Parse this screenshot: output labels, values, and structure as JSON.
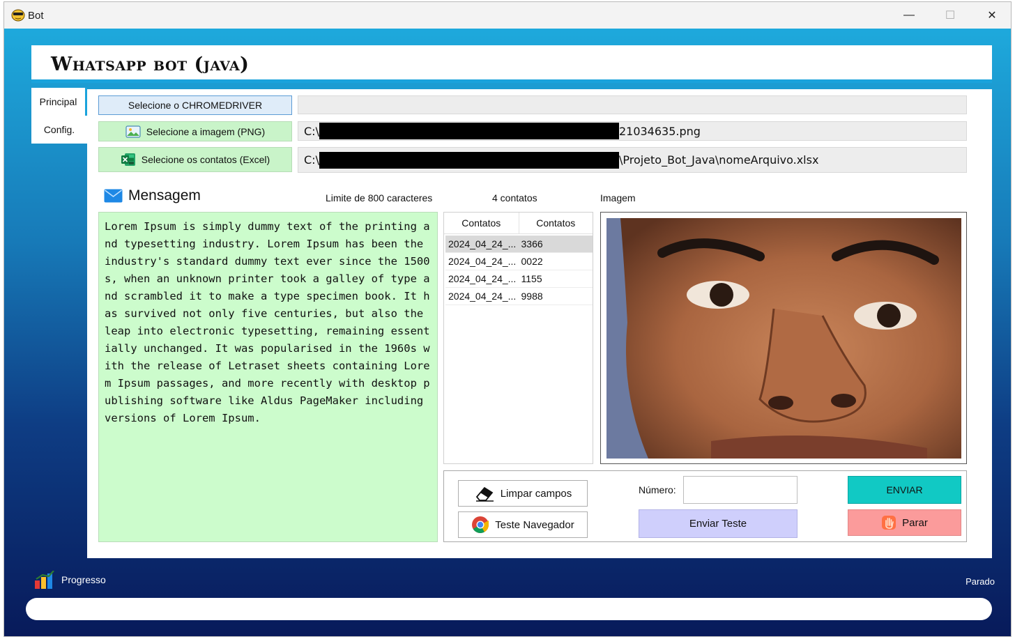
{
  "window": {
    "title": "Bot",
    "minimize_glyph": "—",
    "maximize_glyph": "☐",
    "close_glyph": "✕"
  },
  "header": {
    "app_title": "Whatsapp bot (java)"
  },
  "tabs": [
    {
      "label": "Principal",
      "active": true
    },
    {
      "label": "Config.",
      "active": false
    }
  ],
  "file_selectors": {
    "chromedriver": {
      "button_label": "Selecione o CHROMEDRIVER",
      "path": ""
    },
    "image": {
      "button_label": "Selecione a imagem (PNG)",
      "icon": "image-icon",
      "path_prefix": "C:\\",
      "path_suffix": "21034635.png"
    },
    "contacts": {
      "button_label": "Selecione os contatos (Excel)",
      "icon": "excel-icon",
      "path_prefix": "C:\\",
      "path_suffix": "\\Projeto_Bot_Java\\nomeArquivo.xlsx"
    }
  },
  "message": {
    "title": "Mensagem",
    "icon": "envelope-icon",
    "limit_label": "Limite de 800 caracteres",
    "text": "Lorem Ipsum is simply dummy text of the printing and typesetting industry. Lorem Ipsum has been the industry's standard dummy text ever since the 1500s, when an unknown printer took a galley of type and scrambled it to make a type specimen book. It has survived not only five centuries, but also the leap into electronic typesetting, remaining essentially unchanged. It was popularised in the 1960s with the release of Letraset sheets containing Lorem Ipsum passages, and more recently with desktop publishing software like Aldus PageMaker including versions of Lorem Ipsum."
  },
  "contacts": {
    "count_label": "4 contatos",
    "columns": [
      "Contatos",
      "Contatos"
    ],
    "rows": [
      {
        "name": "2024_04_24_...",
        "number": "3366",
        "selected": true
      },
      {
        "name": "2024_04_24_...",
        "number": "0022",
        "selected": false
      },
      {
        "name": "2024_04_24_...",
        "number": "1155",
        "selected": false
      },
      {
        "name": "2024_04_24_...",
        "number": "9988",
        "selected": false
      }
    ]
  },
  "image_panel": {
    "label": "Imagem"
  },
  "actions": {
    "clear_label": "Limpar campos",
    "browser_test_label": "Teste Navegador",
    "number_label": "Número:",
    "number_value": "",
    "send_label": "ENVIAR",
    "send_test_label": "Enviar Teste",
    "stop_label": "Parar"
  },
  "progress": {
    "label": "Progresso",
    "status": "Parado",
    "value": 0
  },
  "colors": {
    "accent": "#1aa3dc",
    "send": "#11c9c4",
    "stop": "#fb9b9b",
    "test": "#cfcffc",
    "message_bg": "#ccfccc"
  }
}
